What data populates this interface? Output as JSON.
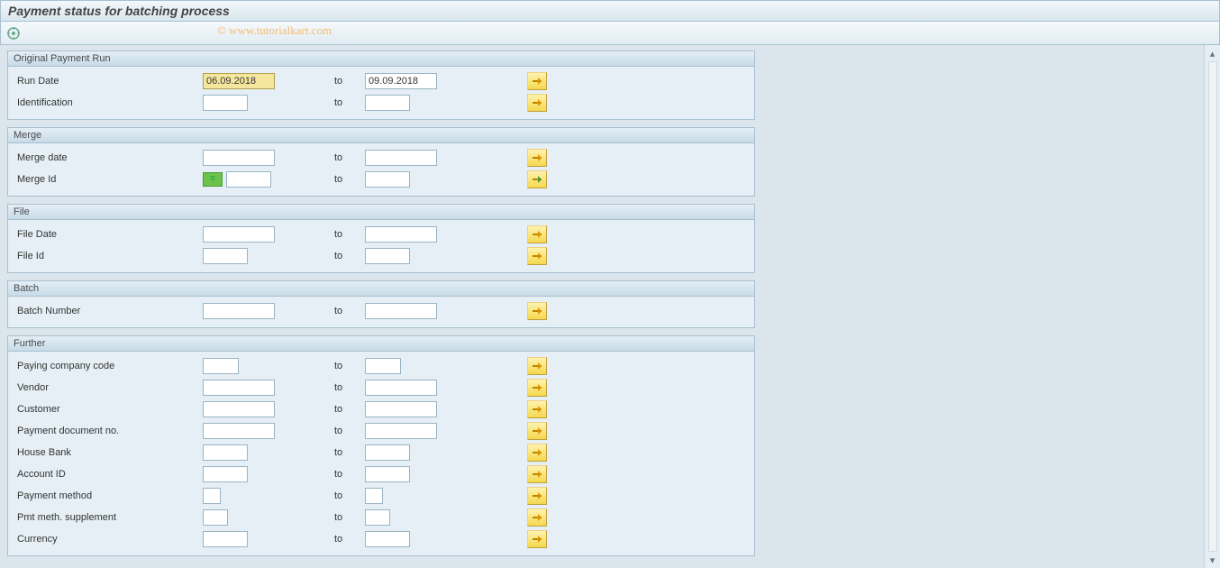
{
  "title": "Payment status for batching process",
  "watermark": "© www.tutorialkart.com",
  "to_label": "to",
  "groups": {
    "original": {
      "header": "Original Payment Run",
      "run_date": {
        "label": "Run Date",
        "from": "06.09.2018",
        "to": "09.09.2018"
      },
      "identification": {
        "label": "Identification",
        "from": "",
        "to": ""
      }
    },
    "merge": {
      "header": "Merge",
      "merge_date": {
        "label": "Merge date",
        "from": "",
        "to": ""
      },
      "merge_id": {
        "label": "Merge Id",
        "from": "",
        "to": ""
      }
    },
    "file": {
      "header": "File",
      "file_date": {
        "label": "File Date",
        "from": "",
        "to": ""
      },
      "file_id": {
        "label": "File Id",
        "from": "",
        "to": ""
      }
    },
    "batch": {
      "header": "Batch",
      "batch_number": {
        "label": "Batch Number",
        "from": "",
        "to": ""
      }
    },
    "further": {
      "header": "Further",
      "paying_cc": {
        "label": "Paying company code",
        "from": "",
        "to": ""
      },
      "vendor": {
        "label": "Vendor",
        "from": "",
        "to": ""
      },
      "customer": {
        "label": "Customer",
        "from": "",
        "to": ""
      },
      "payment_doc": {
        "label": "Payment document no.",
        "from": "",
        "to": ""
      },
      "house_bank": {
        "label": "House Bank",
        "from": "",
        "to": ""
      },
      "account_id": {
        "label": "Account ID",
        "from": "",
        "to": ""
      },
      "payment_method": {
        "label": "Payment method",
        "from": "",
        "to": ""
      },
      "pmt_supp": {
        "label": "Pmt meth. supplement",
        "from": "",
        "to": ""
      },
      "currency": {
        "label": "Currency",
        "from": "",
        "to": ""
      }
    }
  }
}
